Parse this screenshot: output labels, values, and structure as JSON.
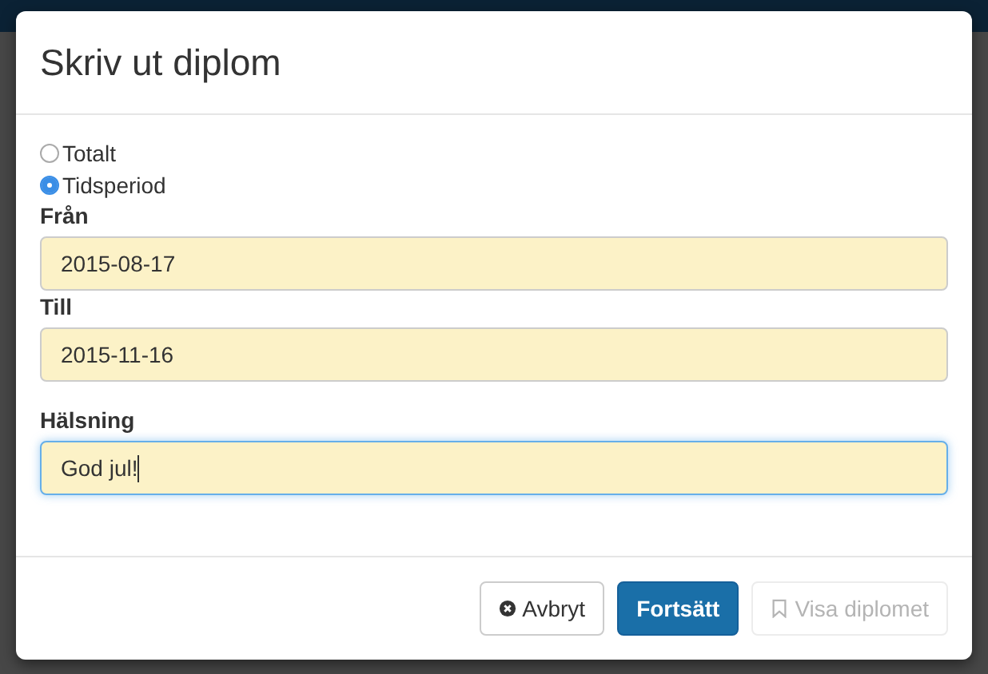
{
  "dialog": {
    "title": "Skriv ut diplom"
  },
  "period_options": [
    {
      "label": "Totalt",
      "selected": false
    },
    {
      "label": "Tidsperiod",
      "selected": true
    }
  ],
  "fields": [
    {
      "label": "Från",
      "value": "2015-08-17",
      "focused": false
    },
    {
      "label": "Till",
      "value": "2015-11-16",
      "focused": false
    },
    {
      "label": "Hälsning",
      "value": "God jul!",
      "focused": true
    }
  ],
  "buttons": [
    {
      "kind": "cancel",
      "label": "Avbryt",
      "disabled": false
    },
    {
      "kind": "primary",
      "label": "Fortsätt",
      "disabled": false
    },
    {
      "kind": "view",
      "label": "Visa diplomet",
      "disabled": true
    }
  ]
}
